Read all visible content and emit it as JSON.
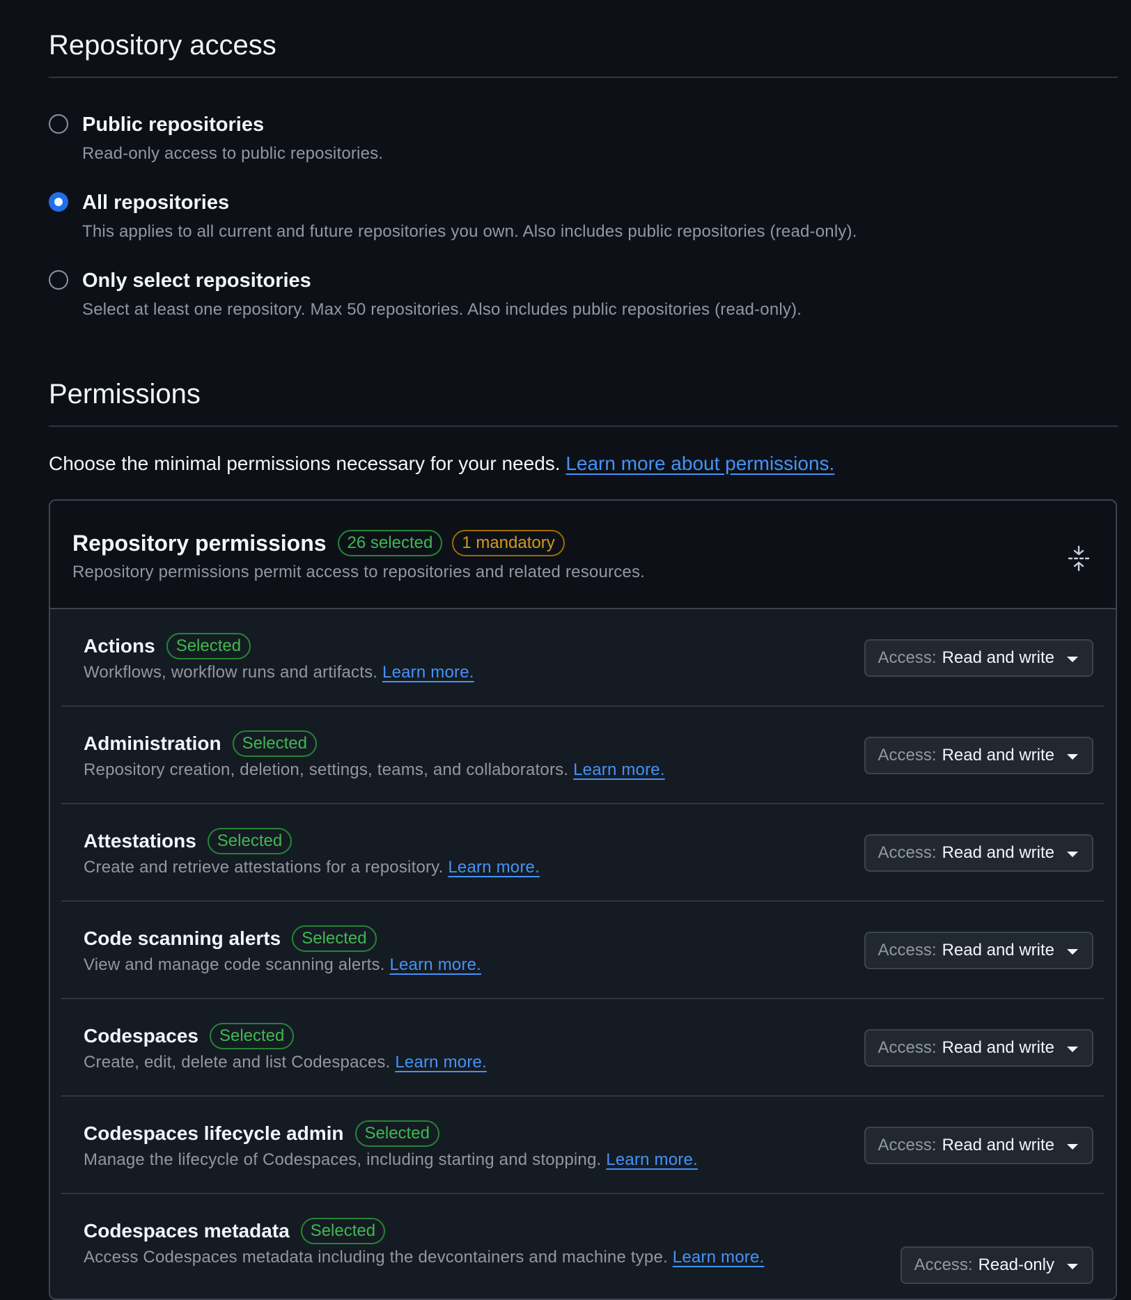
{
  "repository_access": {
    "title": "Repository access",
    "options": [
      {
        "label": "Public repositories",
        "description": "Read-only access to public repositories.",
        "checked": false
      },
      {
        "label": "All repositories",
        "description": "This applies to all current and future repositories you own. Also includes public repositories (read-only).",
        "checked": true
      },
      {
        "label": "Only select repositories",
        "description": "Select at least one repository. Max 50 repositories. Also includes public repositories (read-only).",
        "checked": false
      }
    ]
  },
  "permissions": {
    "title": "Permissions",
    "intro_text": "Choose the minimal permissions necessary for your needs.",
    "intro_link": "Learn more about permissions.",
    "repository_permissions": {
      "title": "Repository permissions",
      "selected_badge": "26 selected",
      "mandatory_badge": "1 mandatory",
      "description": "Repository permissions permit access to repositories and related resources.",
      "collapse_icon": "fold-icon",
      "items": [
        {
          "name": "Actions",
          "badge": "Selected",
          "description": "Workflows, workflow runs and artifacts.",
          "link": "Learn more.",
          "access_prefix": "Access:",
          "access_value": "Read and write"
        },
        {
          "name": "Administration",
          "badge": "Selected",
          "description": "Repository creation, deletion, settings, teams, and collaborators.",
          "link": "Learn more.",
          "access_prefix": "Access:",
          "access_value": "Read and write"
        },
        {
          "name": "Attestations",
          "badge": "Selected",
          "description": "Create and retrieve attestations for a repository.",
          "link": "Learn more.",
          "access_prefix": "Access:",
          "access_value": "Read and write"
        },
        {
          "name": "Code scanning alerts",
          "badge": "Selected",
          "description": "View and manage code scanning alerts.",
          "link": "Learn more.",
          "access_prefix": "Access:",
          "access_value": "Read and write"
        },
        {
          "name": "Codespaces",
          "badge": "Selected",
          "description": "Create, edit, delete and list Codespaces.",
          "link": "Learn more.",
          "access_prefix": "Access:",
          "access_value": "Read and write"
        },
        {
          "name": "Codespaces lifecycle admin",
          "badge": "Selected",
          "description": "Manage the lifecycle of Codespaces, including starting and stopping.",
          "link": "Learn more.",
          "access_prefix": "Access:",
          "access_value": "Read and write"
        },
        {
          "name": "Codespaces metadata",
          "badge": "Selected",
          "description": "Access Codespaces metadata including the devcontainers and machine type.",
          "link": "Learn more.",
          "access_prefix": "Access:",
          "access_value": "Read-only"
        }
      ]
    }
  },
  "colors": {
    "background": "#0d1117",
    "accent": "#1f6feb",
    "link": "#4493f8",
    "success": "#3fb950",
    "attention": "#d29922"
  }
}
